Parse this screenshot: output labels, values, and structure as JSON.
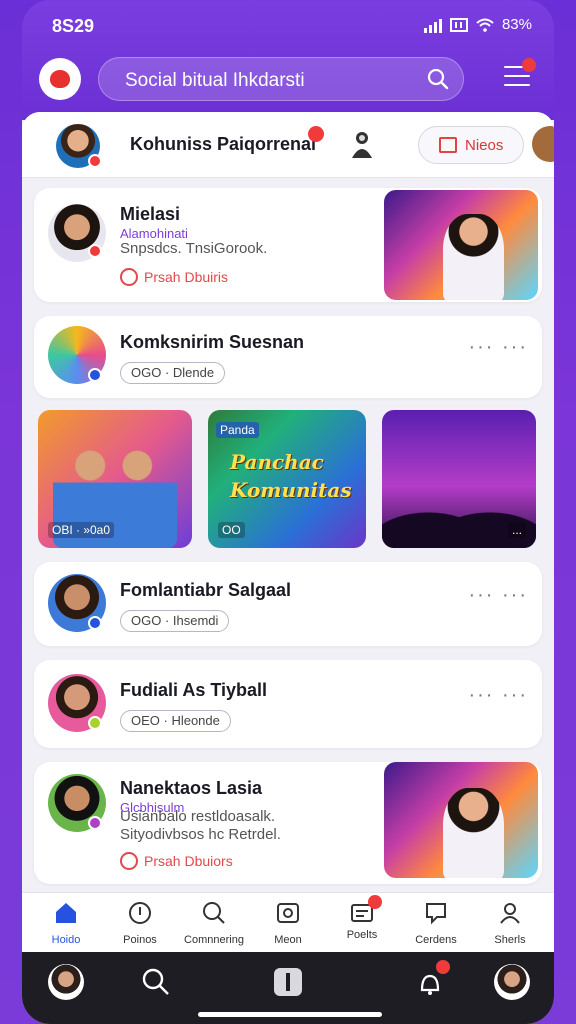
{
  "status": {
    "time": "8S29",
    "battery": "83%"
  },
  "header": {
    "search_placeholder": "Social bitual Ihkdarsti",
    "menu_badge": ""
  },
  "profile_bar": {
    "name": "Kohuniss Paiqorrenai",
    "badge": "",
    "news_label": "Nieos"
  },
  "cards": [
    {
      "title": "Mielasi",
      "tag": "Alamohinati",
      "subtitle": "Snpsdcs. TnsiGorook.",
      "meta": "Prsah Dbuiris"
    },
    {
      "title": "Komksnirim Suesnan",
      "pill": "OGO · Dlende"
    },
    {
      "title": "Fomlantiabr Salgaal",
      "pill": "OGO · Ihsemdi"
    },
    {
      "title": "Fudiali As Tiyball",
      "pill": "OEO · Hleonde"
    },
    {
      "title": "Nanektaos Lasia",
      "tag": "Glcbhisulm",
      "subtitle": "Usianbalo restldoasalk.",
      "subtitle2": "Sityodivbsos hc Retrdel.",
      "meta": "Prsah Dbuiors"
    }
  ],
  "tiles": [
    {
      "caption": "OBI · »0a0"
    },
    {
      "badge": "Panda",
      "title_line1": "Panchac",
      "title_line2": "Komunitas",
      "caption": "OO"
    },
    {
      "caption": "..."
    }
  ],
  "nav": [
    {
      "label": "Hoido",
      "active": true
    },
    {
      "label": "Poinos"
    },
    {
      "label": "Comnnering"
    },
    {
      "label": "Meon"
    },
    {
      "label": "Poelts",
      "badge": ""
    },
    {
      "label": "Cerdens"
    },
    {
      "label": "Sherls"
    }
  ],
  "colors": {
    "accent": "#7a3ee0",
    "badge": "#ef3b3b",
    "link": "#2553e0"
  }
}
